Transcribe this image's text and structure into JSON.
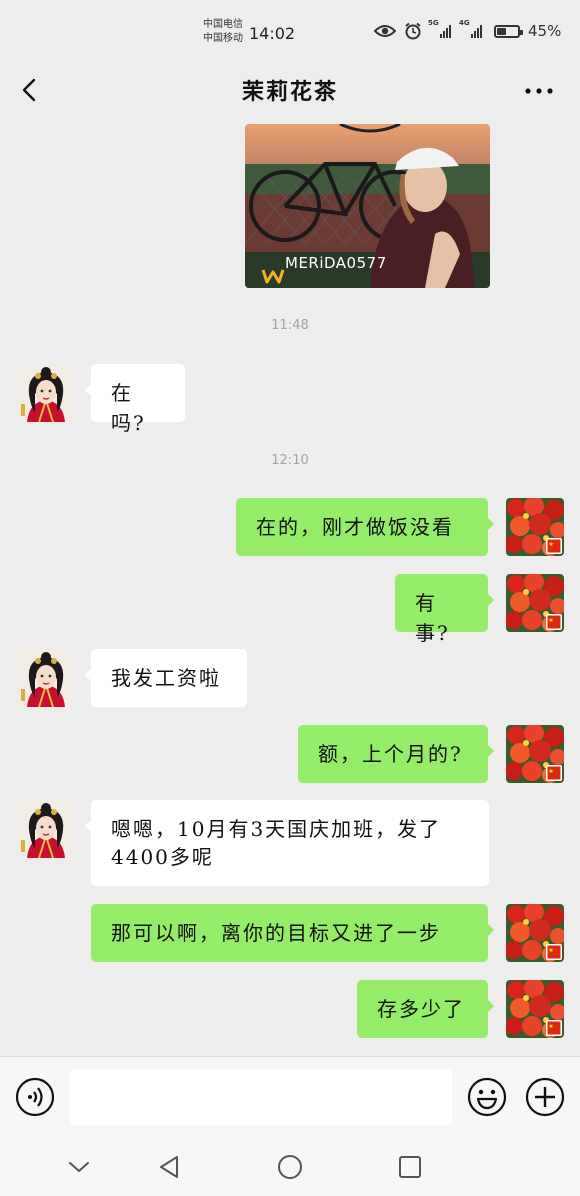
{
  "status_bar": {
    "carrier_1": "中国电信",
    "carrier_2": "中国移动",
    "time": "14:02",
    "network_1": "5G",
    "network_2": "4G",
    "battery_percent": "45%",
    "battery_level": 0.45,
    "icons": [
      "eye-icon",
      "alarm-icon",
      "signal-icon",
      "signal-icon",
      "battery-icon"
    ]
  },
  "header": {
    "title": "茉莉花茶",
    "back_icon": "back-arrow-icon",
    "more_icon": "more-icon"
  },
  "photo_message": {
    "watermark": "MERiDA0577"
  },
  "messages": [
    {
      "type": "time",
      "text": "11:48"
    },
    {
      "type": "in",
      "text": "在吗?"
    },
    {
      "type": "time",
      "text": "12:10"
    },
    {
      "type": "out",
      "text": "在的，刚才做饭没看"
    },
    {
      "type": "out",
      "text": "有事?"
    },
    {
      "type": "in",
      "text": "我发工资啦"
    },
    {
      "type": "out",
      "text": "额，上个月的?"
    },
    {
      "type": "in",
      "text_line1": "嗯嗯，10月有3天国庆加班，发了",
      "text_line2": "4400多呢"
    },
    {
      "type": "out",
      "text": "那可以啊，离你的目标又进了一步"
    },
    {
      "type": "out",
      "text": "存多少了"
    }
  ],
  "input_bar": {
    "value": "",
    "icons": [
      "voice-icon",
      "emoji-icon",
      "plus-icon"
    ]
  },
  "nav_bar": {
    "icons": [
      "collapse-icon",
      "back-triangle-icon",
      "home-circle-icon",
      "recents-square-icon"
    ]
  },
  "colors": {
    "background": "#ededed",
    "outgoing_bubble": "#95ec69",
    "incoming_bubble": "#ffffff",
    "timestamp": "#a3a3a3"
  }
}
